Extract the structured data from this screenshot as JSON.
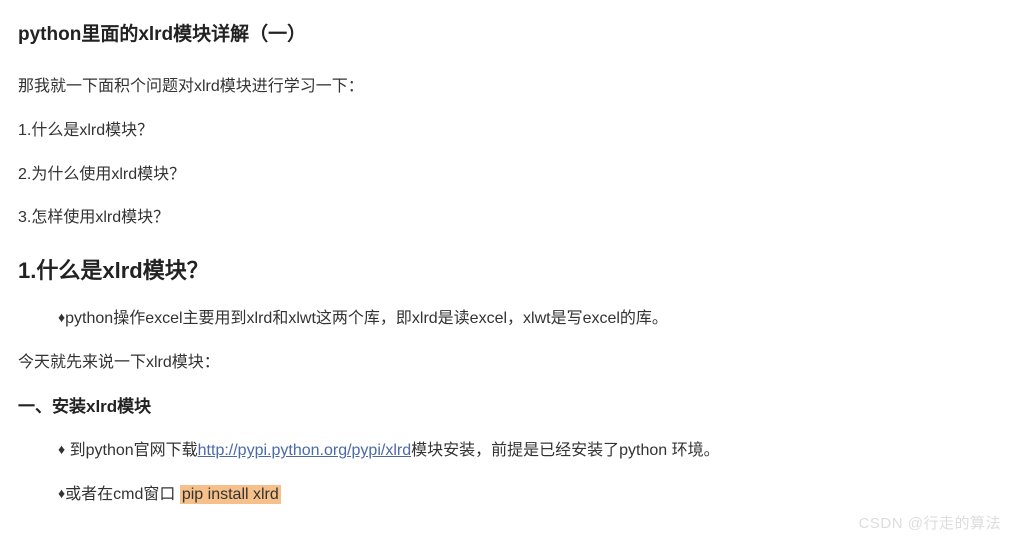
{
  "title": "python里面的xlrd模块详解（一）",
  "intro": "那我就一下面积个问题对xlrd模块进行学习一下：",
  "q1": "1.什么是xlrd模块？",
  "q2": "2.为什么使用xlrd模块？",
  "q3": "3.怎样使用xlrd模块？",
  "section1_heading": "1.什么是xlrd模块？",
  "section1_bullet": "python操作excel主要用到xlrd和xlwt这两个库，即xlrd是读excel，xlwt是写excel的库。",
  "section1_after": "今天就先来说一下xlrd模块：",
  "section2_heading": "一、安装xlrd模块",
  "install_line1_pre": " 到python官网下载",
  "install_line1_link": "http://pypi.python.org/pypi/xlrd",
  "install_line1_post": "模块安装，前提是已经安装了python 环境。",
  "install_line2_pre": "或者在cmd窗口  ",
  "install_line2_cmd": "pip install  xlrd",
  "diamond": "♦",
  "watermark": "CSDN @行走的算法"
}
